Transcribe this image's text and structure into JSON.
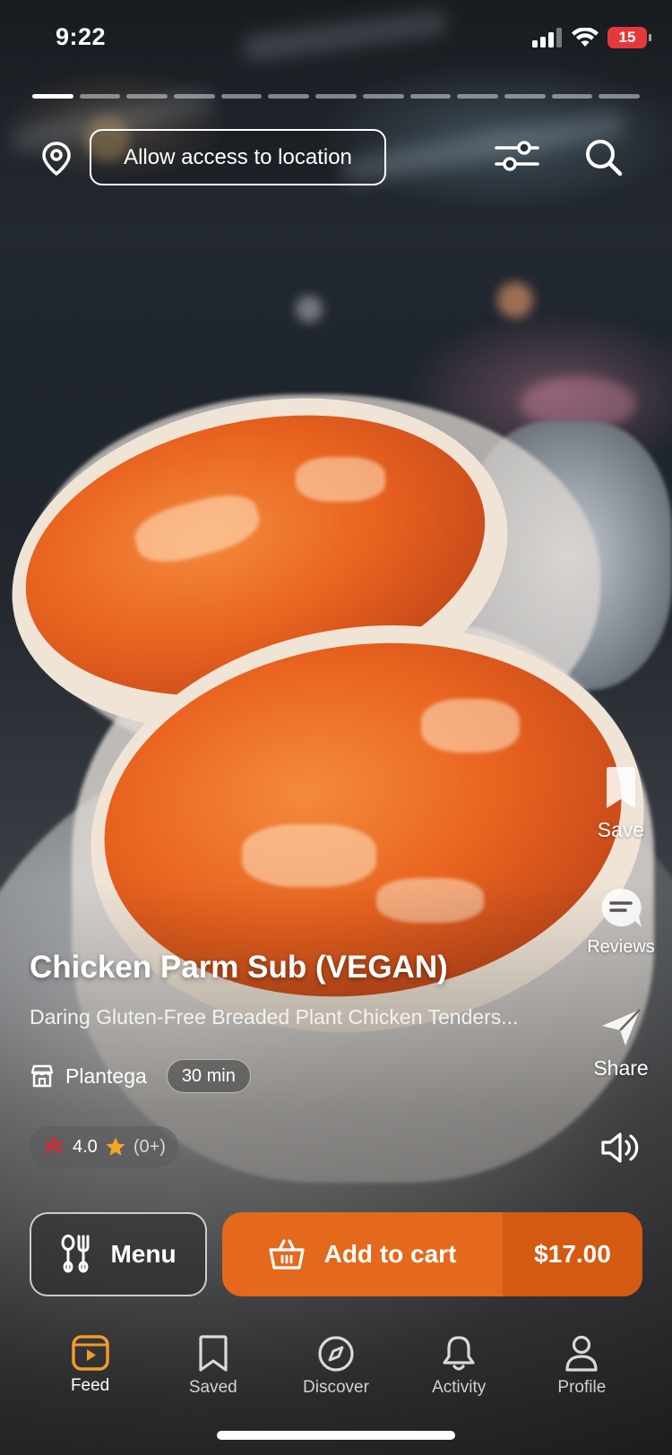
{
  "status_bar": {
    "time": "9:22",
    "battery": "15"
  },
  "header": {
    "location_button": "Allow access to location",
    "progress_segments": 13,
    "progress_active_index": 0
  },
  "actions": {
    "save": "Save",
    "reviews": "Reviews",
    "share": "Share"
  },
  "item": {
    "title": "Chicken Parm Sub (VEGAN)",
    "description": "Daring Gluten-Free Breaded Plant Chicken Tenders...",
    "store": "Plantega",
    "time": "30 min",
    "rating": "4.0",
    "rating_count": "(0+)"
  },
  "buttons": {
    "menu": "Menu",
    "add_to_cart": "Add to cart",
    "price": "$17.00"
  },
  "tabs": [
    {
      "label": "Feed",
      "icon": "feed-icon",
      "active": true
    },
    {
      "label": "Saved",
      "icon": "bookmark-icon",
      "active": false
    },
    {
      "label": "Discover",
      "icon": "compass-icon",
      "active": false
    },
    {
      "label": "Activity",
      "icon": "bell-icon",
      "active": false
    },
    {
      "label": "Profile",
      "icon": "person-icon",
      "active": false
    }
  ],
  "colors": {
    "accent": "#e4691c",
    "accent_dark": "#d45a12",
    "active_tab": "#f29a2e",
    "battery": "#e5383b",
    "yelp": "#e0262b",
    "star": "#f5a623"
  }
}
